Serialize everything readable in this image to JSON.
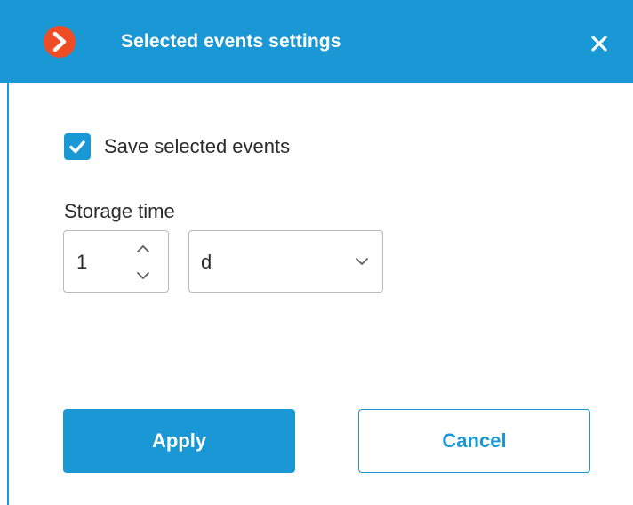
{
  "dialog": {
    "title": "Selected events settings",
    "icons": {
      "app": "app-logo-chevron-icon",
      "close": "close-icon"
    },
    "colors": {
      "accent": "#1a98d5",
      "logo": "#ee4c24",
      "text": "#2b2b2b",
      "border": "#b9b9b9"
    }
  },
  "save_events": {
    "label": "Save selected events",
    "checked": true
  },
  "storage_time": {
    "label": "Storage time",
    "value": "1",
    "unit": "d"
  },
  "buttons": {
    "apply": "Apply",
    "cancel": "Cancel"
  }
}
